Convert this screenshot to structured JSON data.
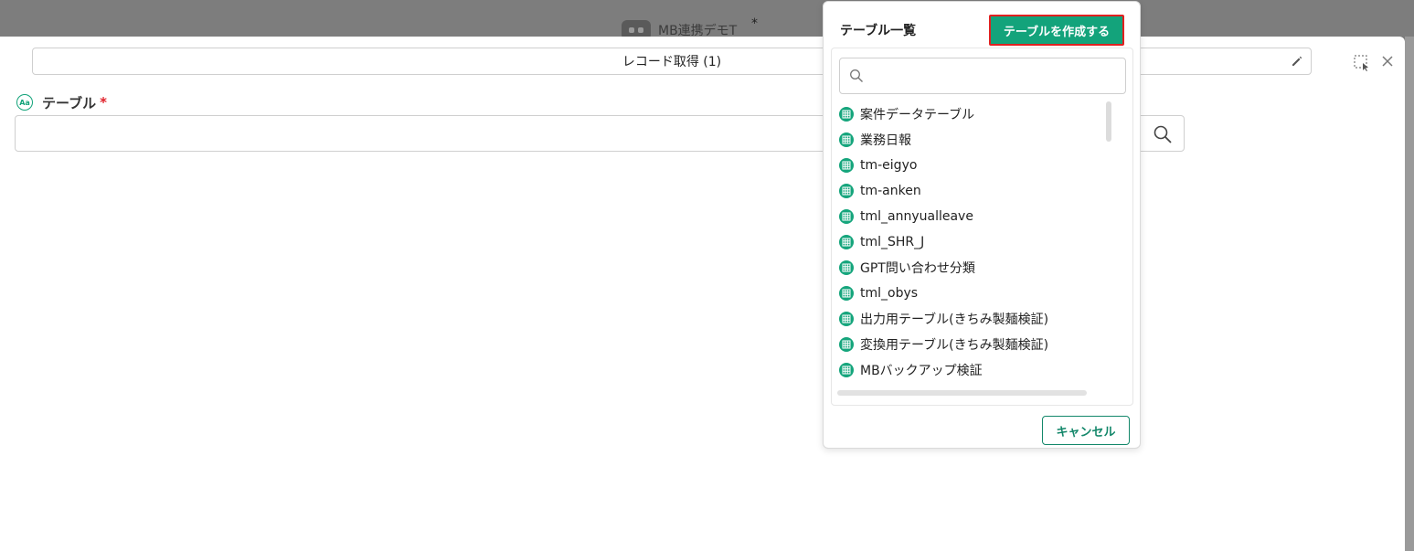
{
  "app": {
    "title": "MB連携デモT",
    "star": "*",
    "icon": "app-robot-icon"
  },
  "node": {
    "name": "レコード取得 (1)",
    "edit_icon": "pencil-icon"
  },
  "window_controls": {
    "select_icon": "selection-cursor-icon",
    "close_icon": "close-icon"
  },
  "field": {
    "label": "テーブル",
    "required_mark": "*",
    "type_icon": "Aa",
    "value": "",
    "search_icon": "search-icon"
  },
  "popover": {
    "title": "テーブル一覧",
    "create_button": "テーブルを作成する",
    "search_placeholder": "",
    "items": [
      "案件データテーブル",
      "業務日報",
      "tm-eigyo",
      "tm-anken",
      "tml_annyualleave",
      "tml_SHR_J",
      "GPT問い合わせ分類",
      "tml_obys",
      "出力用テーブル(きちみ製麺検証)",
      "変換用テーブル(きちみ製麺検証)",
      "MBバックアップ検証"
    ],
    "cancel_button": "キャンセル"
  },
  "colors": {
    "accent": "#13a37b",
    "highlight_border": "#e02020",
    "required": "#e0202a"
  }
}
